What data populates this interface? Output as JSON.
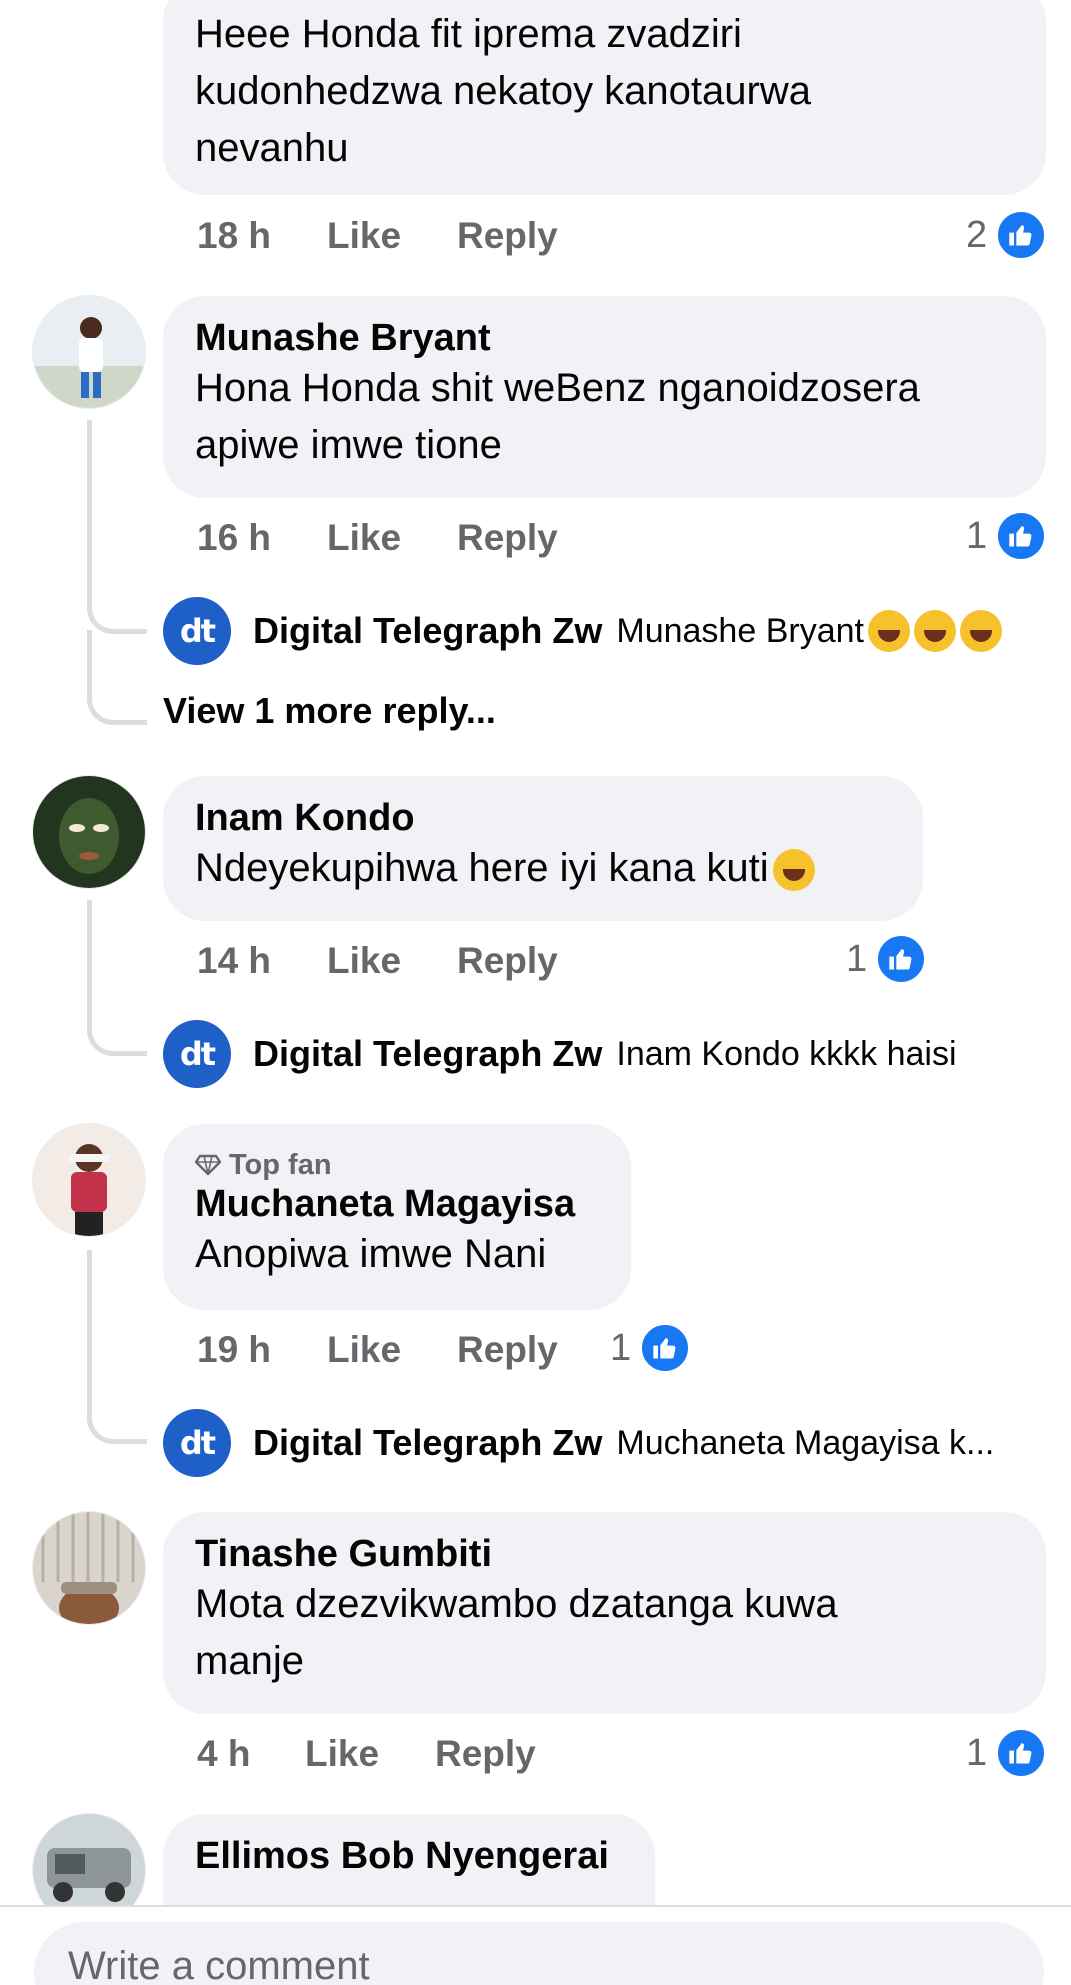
{
  "comments": [
    {
      "name": "",
      "text": "Heee Honda fit iprema zvadziri kudonhedzwa nekatoy kanotaurwa nevanhu",
      "time": "18 h",
      "like_label": "Like",
      "reply_label": "Reply",
      "likes": "2"
    },
    {
      "name": "Munashe Bryant",
      "text": "Hona Honda shit weBenz nganoidzosera apiwe imwe tione",
      "time": "16 h",
      "like_label": "Like",
      "reply_label": "Reply",
      "likes": "1",
      "reply": {
        "author": "Digital Telegraph Zw",
        "text": "Munashe Bryant"
      },
      "view_more": "View 1 more reply..."
    },
    {
      "name": "Inam Kondo",
      "text": "Ndeyekupihwa here iyi kana kuti",
      "time": "14 h",
      "like_label": "Like",
      "reply_label": "Reply",
      "likes": "1",
      "reply": {
        "author": "Digital Telegraph Zw",
        "text": "Inam Kondo kkkk haisi"
      }
    },
    {
      "badge": "Top fan",
      "name": "Muchaneta Magayisa",
      "text": "Anopiwa imwe Nani",
      "time": "19 h",
      "like_label": "Like",
      "reply_label": "Reply",
      "likes": "1",
      "reply": {
        "author": "Digital Telegraph Zw",
        "text": "Muchaneta Magayisa k..."
      }
    },
    {
      "name": "Tinashe Gumbiti",
      "text": "Mota dzezvikwambo dzatanga kuwa manje",
      "time": "4 h",
      "like_label": "Like",
      "reply_label": "Reply",
      "likes": "1"
    },
    {
      "name": "Ellimos Bob Nyengerai",
      "text": ""
    }
  ],
  "logo_text": "dt",
  "composer": {
    "placeholder": "Write a comment"
  },
  "colors": {
    "like_blue": "#1877f2",
    "bubble_bg": "#f0f2f5",
    "meta_gray": "#65676b"
  }
}
